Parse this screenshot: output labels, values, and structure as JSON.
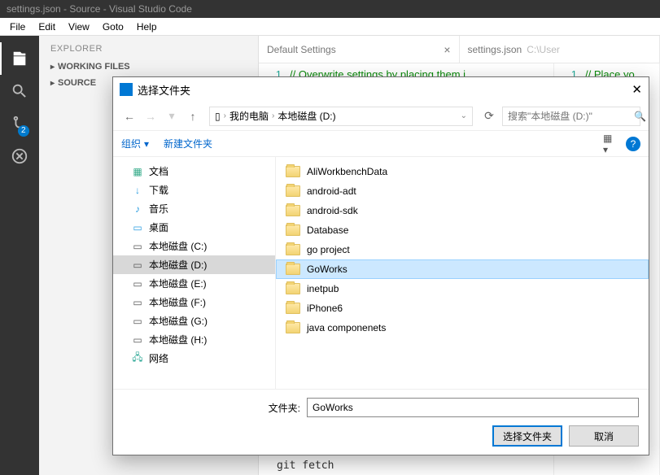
{
  "window": {
    "title": "settings.json - Source - Visual Studio Code"
  },
  "menubar": [
    "File",
    "Edit",
    "View",
    "Goto",
    "Help"
  ],
  "sidebar": {
    "title": "EXPLORER",
    "sections": [
      "WORKING FILES",
      "SOURCE"
    ]
  },
  "activitybar": {
    "badge": "2"
  },
  "tabs": {
    "left": {
      "label": "Default Settings"
    },
    "right": {
      "label": "settings.json",
      "path": "C:\\User"
    }
  },
  "code": {
    "left_line1": "// Overwrite settings by placing them i",
    "left_line2": "{",
    "right_line1": "// Place yo"
  },
  "bottom_code": "git fetch",
  "dialog": {
    "title": "选择文件夹",
    "breadcrumb": {
      "drive_icon": "▯",
      "items": [
        "我的电脑",
        "本地磁盘 (D:)"
      ]
    },
    "search_placeholder": "搜索\"本地磁盘 (D:)\"",
    "toolbar": {
      "organize": "组织",
      "new_folder": "新建文件夹"
    },
    "tree": [
      {
        "icon": "doc",
        "label": "文档",
        "glyph": "▦"
      },
      {
        "icon": "dl",
        "label": "下载",
        "glyph": "↓"
      },
      {
        "icon": "music",
        "label": "音乐",
        "glyph": "♪"
      },
      {
        "icon": "desk",
        "label": "桌面",
        "glyph": "▭"
      },
      {
        "icon": "drive",
        "label": "本地磁盘 (C:)",
        "glyph": "▭"
      },
      {
        "icon": "drive",
        "label": "本地磁盘 (D:)",
        "glyph": "▭",
        "selected": true
      },
      {
        "icon": "drive",
        "label": "本地磁盘 (E:)",
        "glyph": "▭"
      },
      {
        "icon": "drive",
        "label": "本地磁盘 (F:)",
        "glyph": "▭"
      },
      {
        "icon": "drive",
        "label": "本地磁盘 (G:)",
        "glyph": "▭"
      },
      {
        "icon": "drive",
        "label": "本地磁盘 (H:)",
        "glyph": "▭"
      },
      {
        "icon": "net",
        "label": "网络",
        "glyph": "🖧"
      }
    ],
    "files": [
      {
        "label": "AliWorkbenchData"
      },
      {
        "label": "android-adt"
      },
      {
        "label": "android-sdk"
      },
      {
        "label": "Database"
      },
      {
        "label": "go project"
      },
      {
        "label": "GoWorks",
        "selected": true
      },
      {
        "label": "inetpub"
      },
      {
        "label": "iPhone6"
      },
      {
        "label": "java componenets"
      }
    ],
    "filename_label": "文件夹:",
    "filename_value": "GoWorks",
    "btn_select": "选择文件夹",
    "btn_cancel": "取消"
  }
}
